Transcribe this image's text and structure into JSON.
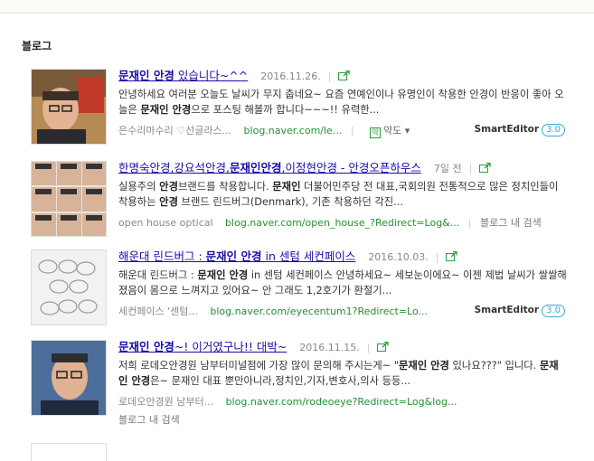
{
  "section": {
    "title": "블로그"
  },
  "results": [
    {
      "title_pre": "",
      "title_bold": "문재인 안경",
      "title_post": " 있습니다~^^",
      "date": "2016.11.26.",
      "desc_parts": [
        {
          "t": "안녕하세요 여러분 오늘도 날씨가 무지 춥네요~ 요즘 연예인이나 유명인이 착용한 안경이 반응이 좋아 오늘은 "
        },
        {
          "t": "문재인 안경",
          "b": true
        },
        {
          "t": "으로 포스팅 해볼까 합니다~~~!! 유력한..."
        }
      ],
      "source": "은수리마수리 ♡선글라스...",
      "url": "blog.naver.com/le...",
      "translate_label": "약도",
      "smarteditor_label": "SmartEditor",
      "smarteditor_version": "3.0"
    },
    {
      "title_pre": "한명숙안경,강요석안경,",
      "title_bold": "문재인안경",
      "title_post": ",이정현안경 - 안경오픈하우스",
      "date": "7일 전",
      "desc_parts": [
        {
          "t": "실용주의 "
        },
        {
          "t": "안경",
          "b": true
        },
        {
          "t": "브랜드를 착용합니다. "
        },
        {
          "t": "문재인",
          "b": true
        },
        {
          "t": " 더불어민주당 전 대표,국회의원 전통적으로 많은 정치인들이 착용하는 "
        },
        {
          "t": "안경",
          "b": true
        },
        {
          "t": " 브랜드 린드버그(Denmark), 기존 착용하던 각진..."
        }
      ],
      "source": "open house optical",
      "url": "blog.naver.com/open_house_?Redirect=Log&...",
      "blog_search": "블로그 내 검색"
    },
    {
      "title_pre": "해운대 린드버그 : ",
      "title_bold": "문재인 안경",
      "title_post": " in 센텀 세컨페이스",
      "date": "2016.10.03.",
      "desc_parts": [
        {
          "t": "해운대 린드버그 : "
        },
        {
          "t": "문재인 안경",
          "b": true
        },
        {
          "t": " in 센텀 세컨페이스 안녕하세요~ 세보눈이에요~ 이젠 제법 날씨가 쌀쌀해졌음이 몸으로 느껴지고 있어요~ 안 그래도 1,2호기가 환절기..."
        }
      ],
      "source": "세컨페이스 '센텀...",
      "url": "blog.naver.com/eyecentum1?Redirect=Lo...",
      "smarteditor_label": "SmartEditor",
      "smarteditor_version": "3.0"
    },
    {
      "title_pre": "",
      "title_bold": "문재인 안경",
      "title_post": "~! 이거였구나!! 대박~",
      "date": "2016.11.15.",
      "desc_parts": [
        {
          "t": "저희 로데오안경원 남부터미널점에 가장 많이 문의해 주시는게~ \""
        },
        {
          "t": "문재인 안경",
          "b": true
        },
        {
          "t": " 있나요???\" 입니다. "
        },
        {
          "t": "문재인 안경",
          "b": true
        },
        {
          "t": "은~ 문재인 대표 뿐만아니라,정치인,기자,변호사,의사 등등..."
        }
      ],
      "source": "로데오안경원 남부터...",
      "url": "blog.naver.com/rodeoeye?Redirect=Log&log...",
      "blog_search": "블로그 내 검색"
    }
  ],
  "colors": {
    "link": "#1a0dab",
    "url": "#229133",
    "accent": "#3aa8d6"
  }
}
